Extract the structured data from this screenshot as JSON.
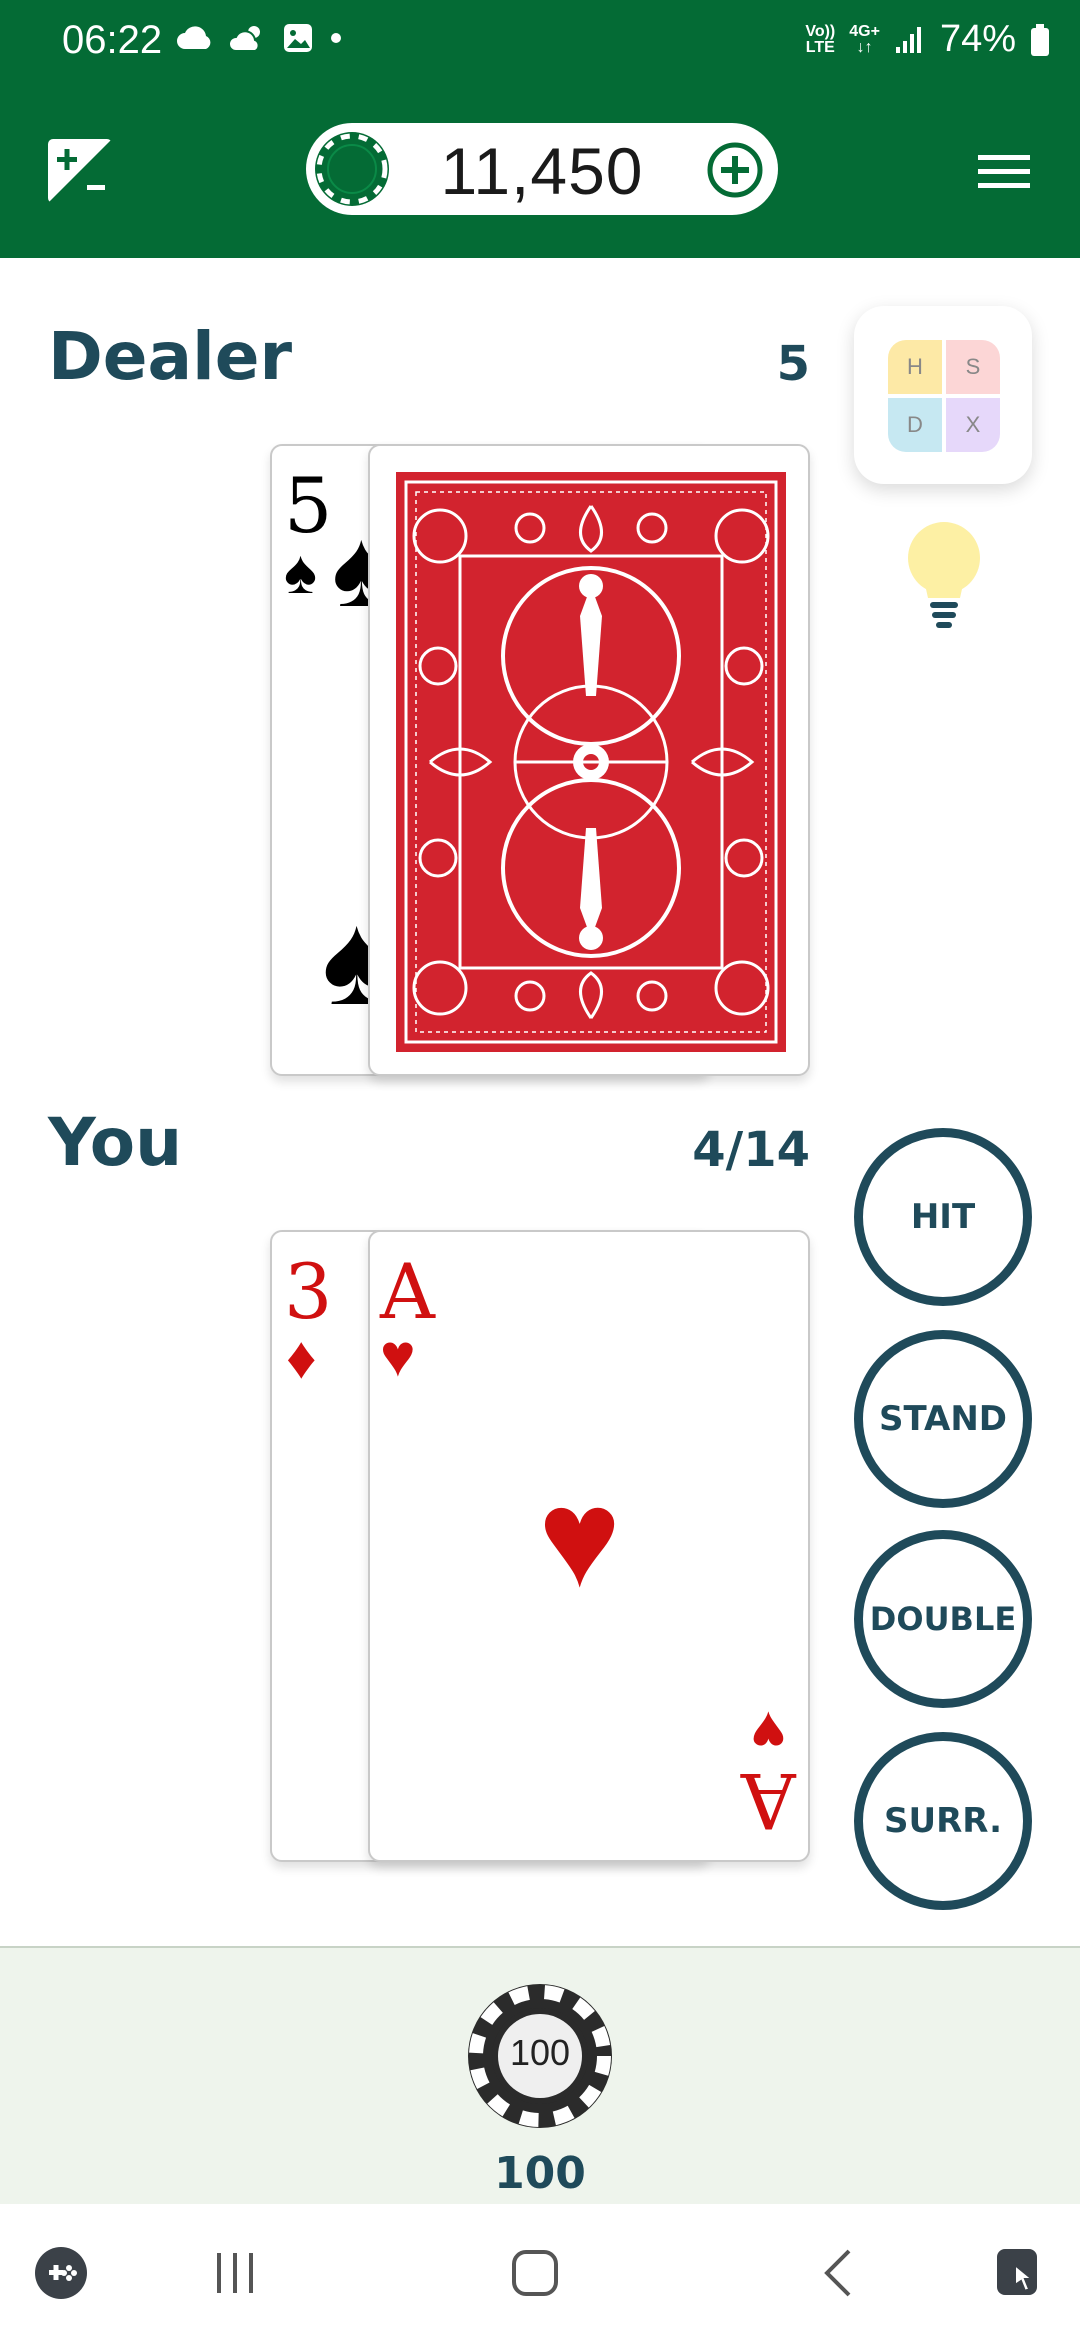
{
  "status_bar": {
    "time": "06:22",
    "net_top": "Vo))",
    "net_bottom": "LTE",
    "net2_top": "4G+",
    "battery": "74%"
  },
  "header": {
    "balance": "11,450",
    "icons": [
      "plus-minus-icon",
      "chip-icon",
      "add-circle-icon",
      "menu-icon"
    ]
  },
  "dealer": {
    "label": "Dealer",
    "score": "5",
    "cards": [
      {
        "rank": "5",
        "suit": "♠",
        "color": "black"
      },
      {
        "rank": "",
        "suit": "",
        "face": "back"
      }
    ]
  },
  "player": {
    "label": "You",
    "score": "4/14",
    "cards": [
      {
        "rank": "3",
        "suit": "♦",
        "color": "red"
      },
      {
        "rank": "A",
        "suit": "♥",
        "color": "red"
      }
    ]
  },
  "hint": {
    "cells": [
      "H",
      "S",
      "D",
      "X"
    ]
  },
  "actions": {
    "hit": "HIT",
    "stand": "STAND",
    "double": "DOUBLE",
    "surrender": "SURR."
  },
  "bet": {
    "chip_label": "100",
    "amount": "100"
  },
  "colors": {
    "header_green": "#046b35",
    "text_teal": "#1f4a5a",
    "card_red": "#d01010",
    "bet_area": "#eef4ec"
  }
}
